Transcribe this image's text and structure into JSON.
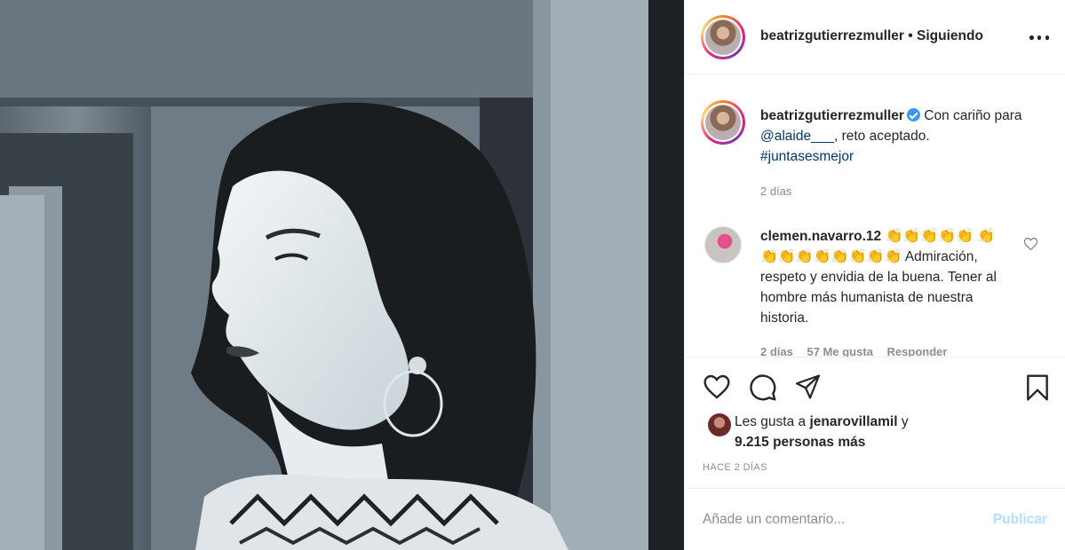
{
  "post": {
    "username": "beatrizgutierrezmuller",
    "follow_separator": "•",
    "follow_status": "Siguiendo"
  },
  "caption": {
    "username": "beatrizgutierrezmuller",
    "text_before": "Con cariño para ",
    "mention": "@alaide___",
    "text_after": ", reto aceptado.",
    "hashtag": "#juntasesmejor",
    "time": "2 días"
  },
  "comment": {
    "username": "clemen.navarro.12",
    "claps_line1": "👏👏👏👏👏",
    "claps_line2": "👏👏👏👏👏👏👏👏👏",
    "text": "Admiración, respeto y envidia de la buena. Tener al hombre más humanista de nuestra historia.",
    "time": "2 días",
    "likes": "57 Me gusta",
    "reply": "Responder"
  },
  "likes": {
    "prefix": "Les gusta a ",
    "user": "jenarovillamil",
    "suffix": " y",
    "others": "9.215 personas más"
  },
  "post_time": "HACE 2 DÍAS",
  "add_comment": {
    "placeholder": "Añade un comentario...",
    "publish": "Publicar"
  },
  "icons": {
    "more": "more-options-icon",
    "like": "heart-icon",
    "comment": "comment-icon",
    "share": "paper-plane-icon",
    "save": "bookmark-icon",
    "verified": "verified-badge-icon"
  },
  "colors": {
    "link": "#00376b",
    "verified": "#3897f0",
    "muted": "#8e8e8e",
    "publish_disabled": "#b2dffc"
  }
}
